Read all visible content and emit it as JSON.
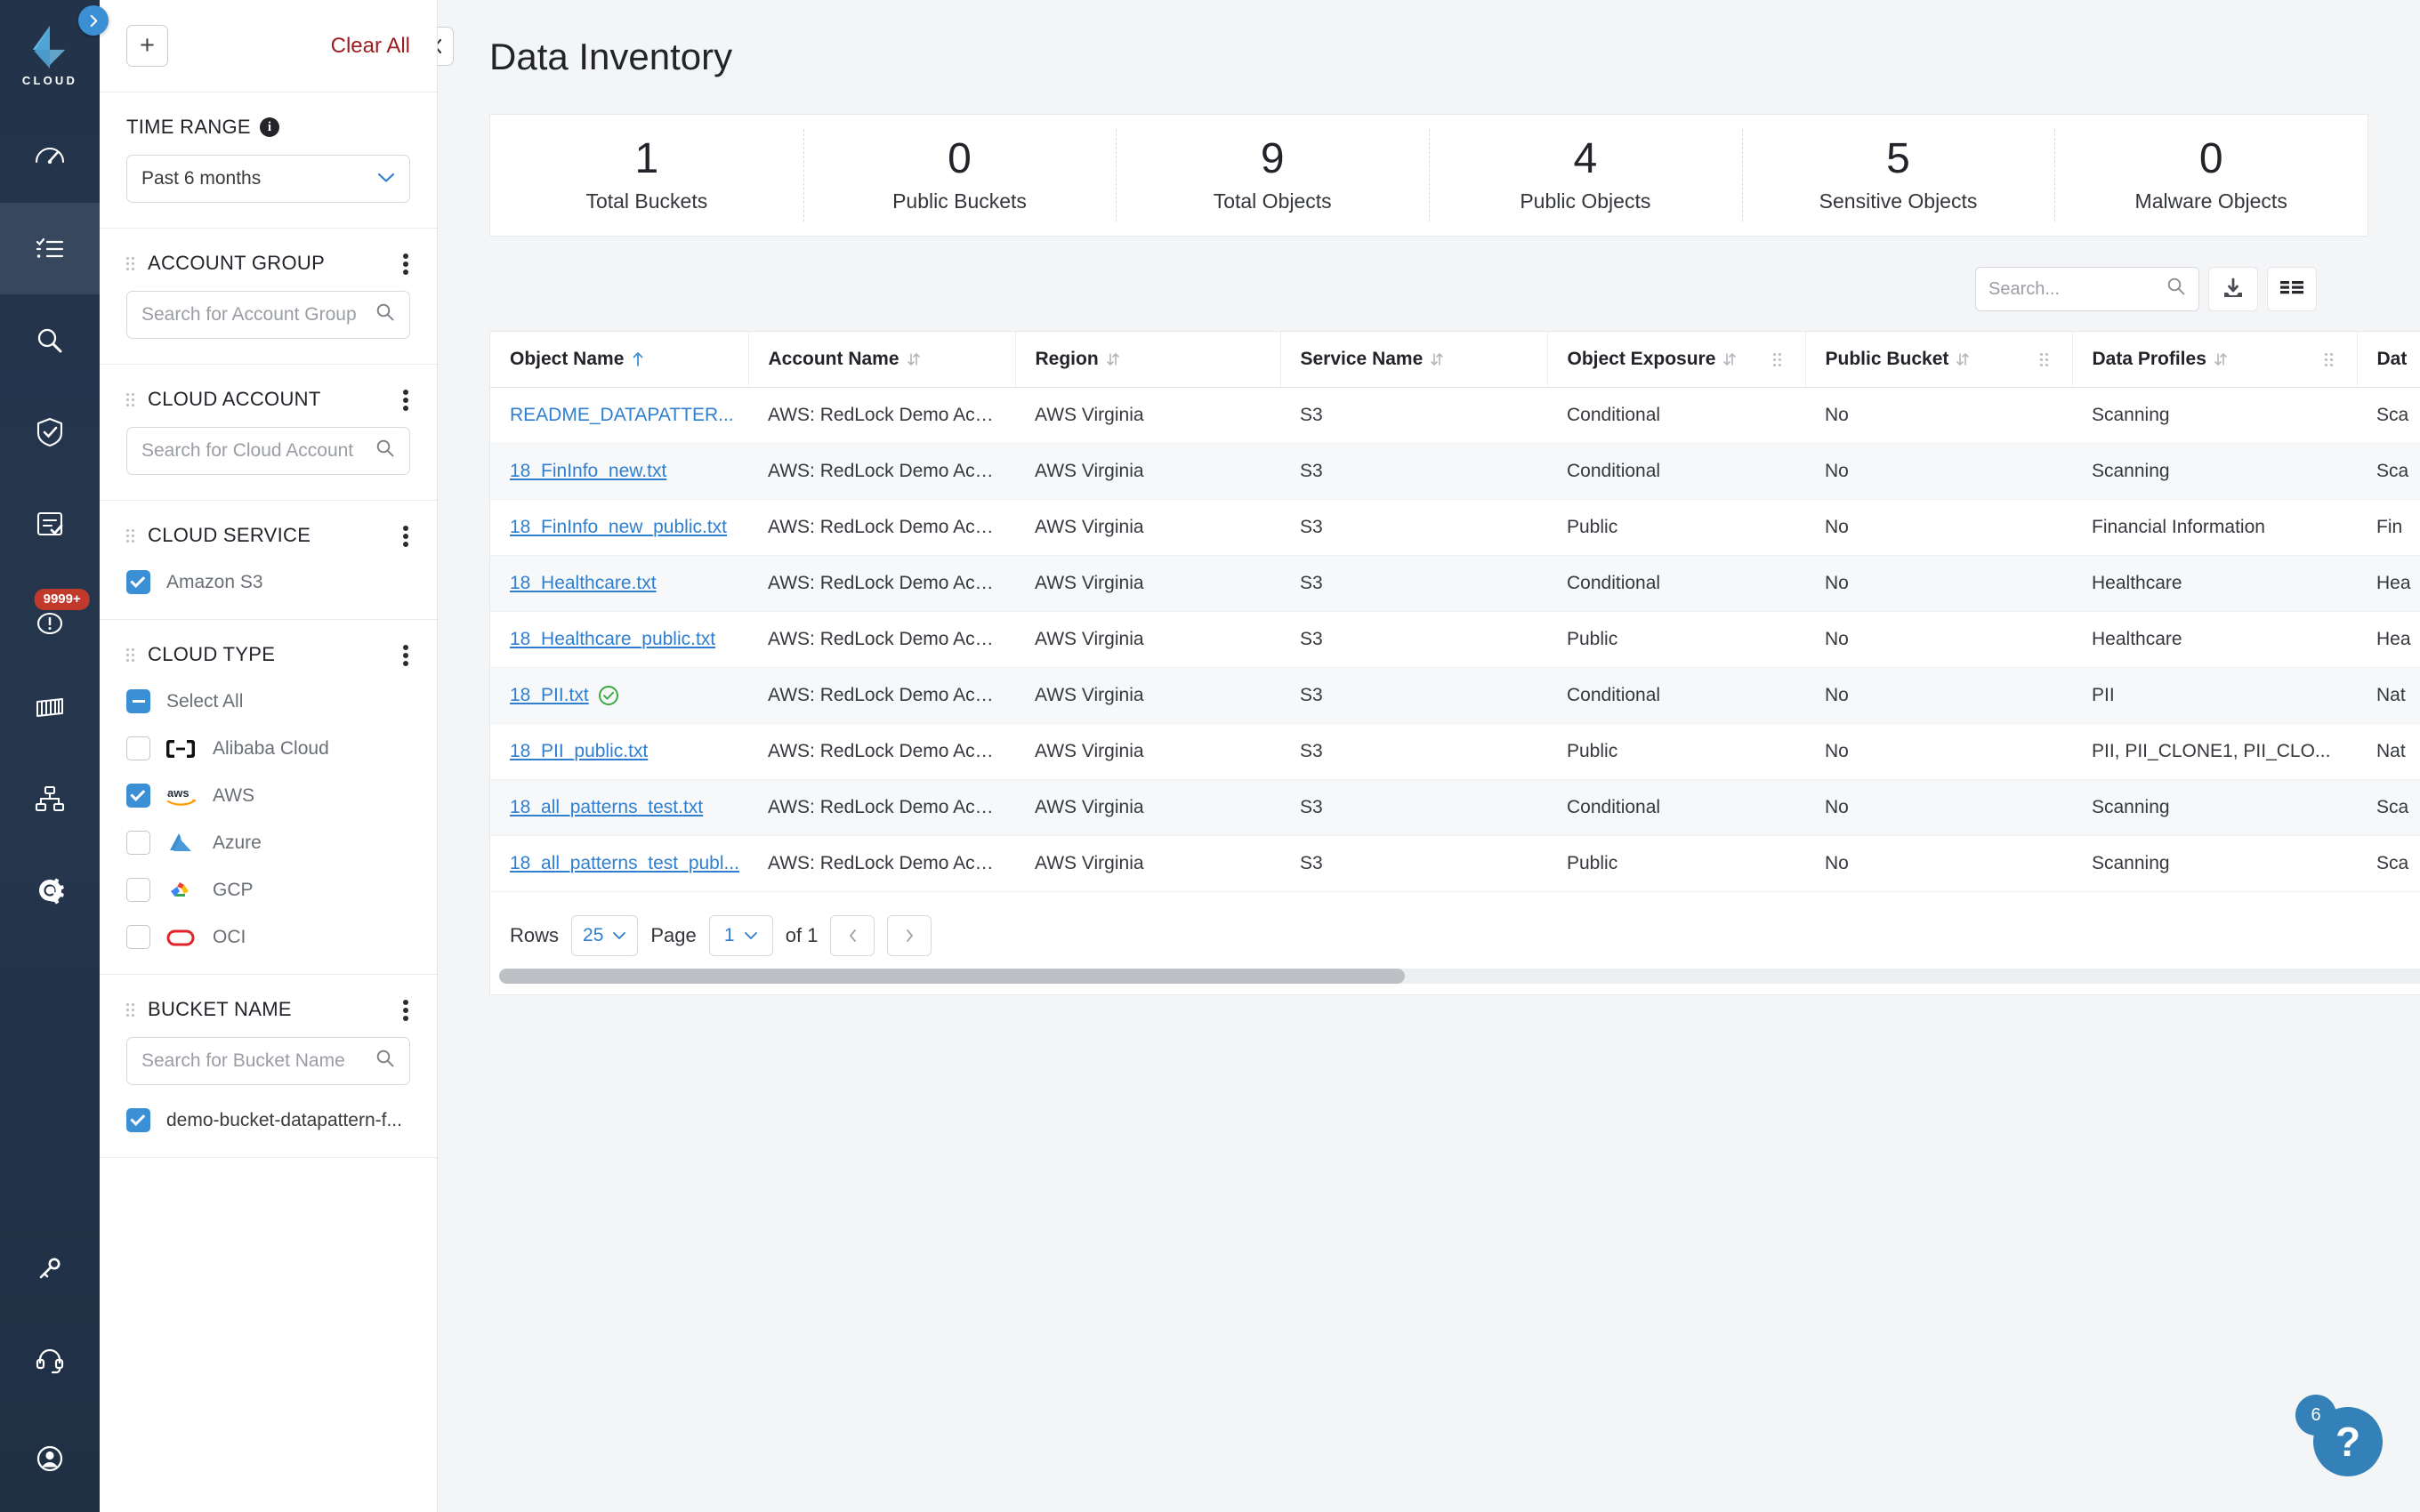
{
  "brand": {
    "word": "CLOUD"
  },
  "rail": {
    "expand_icon": "chevron-right-icon",
    "items": [
      {
        "icon": "dashboard-gauge-icon",
        "active": false
      },
      {
        "icon": "checklist-icon",
        "active": true
      },
      {
        "icon": "search-magnifier-icon",
        "active": false
      },
      {
        "icon": "shield-check-icon",
        "active": false
      },
      {
        "icon": "report-check-icon",
        "active": false
      },
      {
        "icon": "alert-circle-icon",
        "active": false,
        "badge": "9999+"
      },
      {
        "icon": "container-icon",
        "active": false
      },
      {
        "icon": "network-nodes-icon",
        "active": false
      },
      {
        "icon": "settings-gear-icon",
        "active": false
      }
    ],
    "bottom_items": [
      {
        "icon": "key-icon"
      },
      {
        "icon": "support-headset-icon"
      },
      {
        "icon": "user-avatar-icon"
      }
    ]
  },
  "filters": {
    "add_label": "+",
    "clear_all_label": "Clear All",
    "time_range": {
      "title": "TIME RANGE",
      "info_icon": "info-icon",
      "value": "Past 6 months"
    },
    "sections": [
      {
        "title": "ACCOUNT GROUP",
        "search_placeholder": "Search for Account Group"
      },
      {
        "title": "CLOUD ACCOUNT",
        "search_placeholder": "Search for Cloud Account"
      }
    ],
    "cloud_service": {
      "title": "CLOUD SERVICE",
      "options": [
        {
          "label": "Amazon S3",
          "checked": true
        }
      ]
    },
    "cloud_type": {
      "title": "CLOUD TYPE",
      "select_all_label": "Select All",
      "select_all_state": "indeterminate",
      "options": [
        {
          "label": "Alibaba Cloud",
          "checked": false,
          "icon": "alibaba-cloud-logo"
        },
        {
          "label": "AWS",
          "checked": true,
          "icon": "aws-logo"
        },
        {
          "label": "Azure",
          "checked": false,
          "icon": "azure-logo"
        },
        {
          "label": "GCP",
          "checked": false,
          "icon": "gcp-logo"
        },
        {
          "label": "OCI",
          "checked": false,
          "icon": "oci-logo"
        }
      ]
    },
    "bucket_name": {
      "title": "BUCKET NAME",
      "search_placeholder": "Search for Bucket Name",
      "options": [
        {
          "label": "demo-bucket-datapattern-f...",
          "checked": true
        }
      ]
    }
  },
  "header": {
    "title": "Data Inventory",
    "collapse_icon": "chevron-left-icon"
  },
  "stats": [
    {
      "value": "1",
      "label": "Total Buckets"
    },
    {
      "value": "0",
      "label": "Public Buckets"
    },
    {
      "value": "9",
      "label": "Total Objects"
    },
    {
      "value": "4",
      "label": "Public Objects"
    },
    {
      "value": "5",
      "label": "Sensitive Objects"
    },
    {
      "value": "0",
      "label": "Malware Objects"
    }
  ],
  "toolbar": {
    "search_placeholder": "Search...",
    "search_value": "",
    "download_icon": "download-icon",
    "columns_icon": "column-settings-icon"
  },
  "table": {
    "columns": [
      {
        "label": "Object Name",
        "sort": "asc",
        "grip": false
      },
      {
        "label": "Account Name",
        "sort": "both",
        "grip": false
      },
      {
        "label": "Region",
        "sort": "both",
        "grip": false
      },
      {
        "label": "Service Name",
        "sort": "both",
        "grip": false
      },
      {
        "label": "Object Exposure",
        "sort": "both",
        "grip": true
      },
      {
        "label": "Public Bucket",
        "sort": "both",
        "grip": true
      },
      {
        "label": "Data Profiles",
        "sort": "both",
        "grip": true
      },
      {
        "label": "Dat",
        "sort": "none",
        "grip": false
      }
    ],
    "rows": [
      {
        "object_name": "README_DATAPATTER...",
        "badge": false,
        "account_name": "AWS: RedLock Demo Acc...",
        "region": "AWS Virginia",
        "service_name": "S3",
        "object_exposure": "Conditional",
        "public_bucket": "No",
        "data_profiles": "Scanning",
        "next": "Sca"
      },
      {
        "object_name": "18_FinInfo_new.txt",
        "badge": false,
        "account_name": "AWS: RedLock Demo Acc...",
        "region": "AWS Virginia",
        "service_name": "S3",
        "object_exposure": "Conditional",
        "public_bucket": "No",
        "data_profiles": "Scanning",
        "next": "Sca"
      },
      {
        "object_name": "18_FinInfo_new_public.txt",
        "badge": false,
        "account_name": "AWS: RedLock Demo Acc...",
        "region": "AWS Virginia",
        "service_name": "S3",
        "object_exposure": "Public",
        "public_bucket": "No",
        "data_profiles": "Financial Information",
        "next": "Fin"
      },
      {
        "object_name": "18_Healthcare.txt",
        "badge": false,
        "account_name": "AWS: RedLock Demo Acc...",
        "region": "AWS Virginia",
        "service_name": "S3",
        "object_exposure": "Conditional",
        "public_bucket": "No",
        "data_profiles": "Healthcare",
        "next": "Hea"
      },
      {
        "object_name": "18_Healthcare_public.txt",
        "badge": false,
        "account_name": "AWS: RedLock Demo Acc...",
        "region": "AWS Virginia",
        "service_name": "S3",
        "object_exposure": "Public",
        "public_bucket": "No",
        "data_profiles": "Healthcare",
        "next": "Hea"
      },
      {
        "object_name": "18_PII.txt",
        "badge": true,
        "account_name": "AWS: RedLock Demo Acc...",
        "region": "AWS Virginia",
        "service_name": "S3",
        "object_exposure": "Conditional",
        "public_bucket": "No",
        "data_profiles": "PII",
        "next": "Nat"
      },
      {
        "object_name": "18_PII_public.txt",
        "badge": false,
        "account_name": "AWS: RedLock Demo Acc...",
        "region": "AWS Virginia",
        "service_name": "S3",
        "object_exposure": "Public",
        "public_bucket": "No",
        "data_profiles": "PII, PII_CLONE1, PII_CLO...",
        "next": "Nat"
      },
      {
        "object_name": "18_all_patterns_test.txt",
        "badge": false,
        "account_name": "AWS: RedLock Demo Acc...",
        "region": "AWS Virginia",
        "service_name": "S3",
        "object_exposure": "Conditional",
        "public_bucket": "No",
        "data_profiles": "Scanning",
        "next": "Sca"
      },
      {
        "object_name": "18_all_patterns_test_publ...",
        "badge": false,
        "account_name": "AWS: RedLock Demo Acc...",
        "region": "AWS Virginia",
        "service_name": "S3",
        "object_exposure": "Public",
        "public_bucket": "No",
        "data_profiles": "Scanning",
        "next": "Sca"
      }
    ]
  },
  "pagination": {
    "rows_label": "Rows",
    "rows_value": "25",
    "page_label": "Page",
    "page_value": "1",
    "of_label": "of 1",
    "prev_icon": "chevron-left-icon",
    "next_icon": "chevron-right-icon"
  },
  "help": {
    "badge": "6",
    "glyph": "?"
  }
}
